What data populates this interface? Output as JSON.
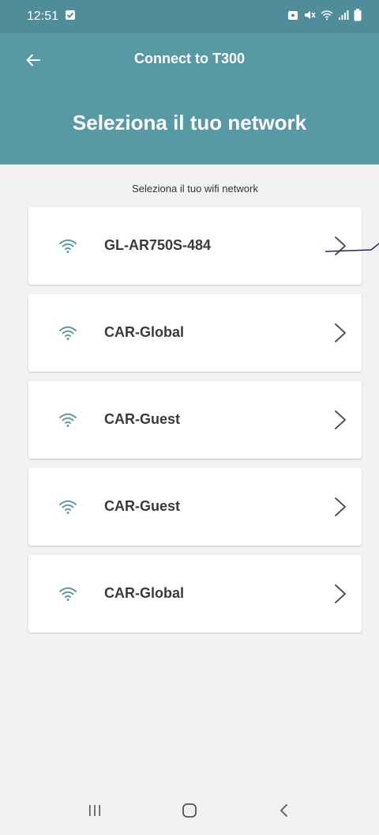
{
  "status_bar": {
    "time": "12:51",
    "left_icons": [
      "checkbox-notification-icon"
    ],
    "right_icons": [
      "lock-icon",
      "mute-icon",
      "wifi-icon",
      "signal-icon",
      "battery-icon"
    ]
  },
  "app_bar": {
    "title": "Connect to T300",
    "back_icon": "arrow-left-icon"
  },
  "header": {
    "title": "Seleziona il tuo network"
  },
  "subtitle": "Seleziona il tuo wifi network",
  "networks": [
    {
      "name": "GL-AR750S-484",
      "icon": "wifi-icon",
      "chevron": "chevron-right-icon"
    },
    {
      "name": "CAR-Global",
      "icon": "wifi-icon",
      "chevron": "chevron-right-icon"
    },
    {
      "name": "CAR-Guest",
      "icon": "wifi-icon",
      "chevron": "chevron-right-icon"
    },
    {
      "name": "CAR-Guest",
      "icon": "wifi-icon",
      "chevron": "chevron-right-icon"
    },
    {
      "name": "CAR-Global",
      "icon": "wifi-icon",
      "chevron": "chevron-right-icon"
    }
  ],
  "nav_bar": {
    "buttons": [
      "recents-icon",
      "home-icon",
      "back-icon"
    ]
  },
  "colors": {
    "status_bar": "#4e8d99",
    "app_bar": "#579aa6",
    "background": "#f2f2f2",
    "card": "#ffffff",
    "wifi_icon": "#5b9aa5",
    "annotation": "#1f2a6b"
  }
}
